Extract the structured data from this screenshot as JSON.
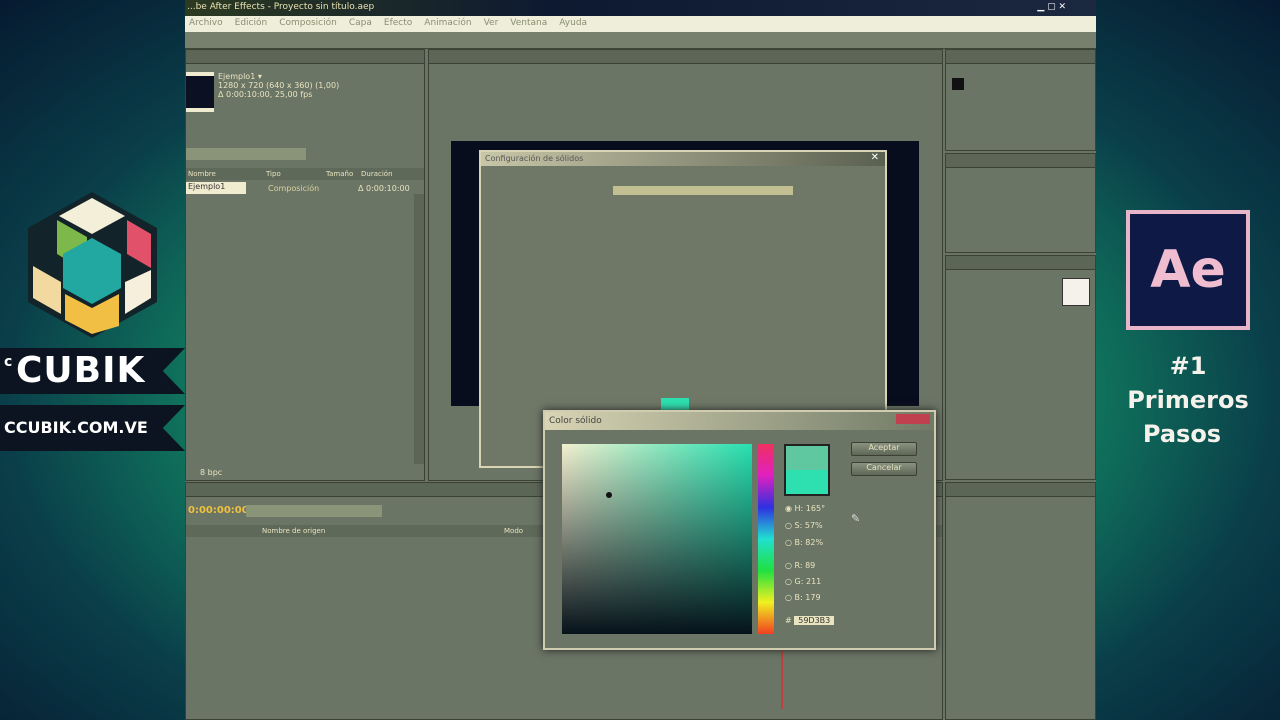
{
  "branding": {
    "logo_text": "CUBIK",
    "logo_prefix": "c",
    "website": "CCUBIK.COM.VE",
    "ae_logo": "Ae",
    "episode": "#1",
    "lesson_line1": "Primeros",
    "lesson_line2": "Pasos"
  },
  "app": {
    "title": "...be After Effects - Proyecto sin título.aep",
    "menu": [
      "Archivo",
      "Edición",
      "Composición",
      "Capa",
      "Efecto",
      "Animación",
      "Ver",
      "Ventana",
      "Ayuda"
    ],
    "project": {
      "comp_name": "Ejemplo1 ▾",
      "comp_size": "1280 x 720  (640 x 360) (1,00)",
      "comp_duration": "Δ 0:00:10:00, 25,00 fps",
      "columns": [
        "Nombre",
        "Tipo",
        "Tamaño",
        "Duración"
      ],
      "items": [
        {
          "name": "Ejemplo1",
          "type": "Composición",
          "duration": "Δ 0:00:10:00"
        }
      ],
      "bpc": "8 bpc"
    },
    "timeline": {
      "timecode": "0:00:00:00",
      "layer_col": "Nombre de origen",
      "mode_col": "Modo"
    },
    "color_dialog": {
      "title": "Color sólido",
      "ok": "Aceptar",
      "cancel": "Cancelar",
      "fields": [
        {
          "label": "H:",
          "value": "165°"
        },
        {
          "label": "S:",
          "value": "57%"
        },
        {
          "label": "B:",
          "value": "82%"
        },
        {
          "label": "R:",
          "value": "89"
        },
        {
          "label": "G:",
          "value": "211"
        },
        {
          "label": "B:",
          "value": "179"
        }
      ],
      "hex_label": "#",
      "hex": "59D3B3",
      "new_color": "#2ee0b0",
      "old_color": "#5fc8a0"
    },
    "solid_dialog": {
      "title": "Configuración de sólidos"
    }
  }
}
